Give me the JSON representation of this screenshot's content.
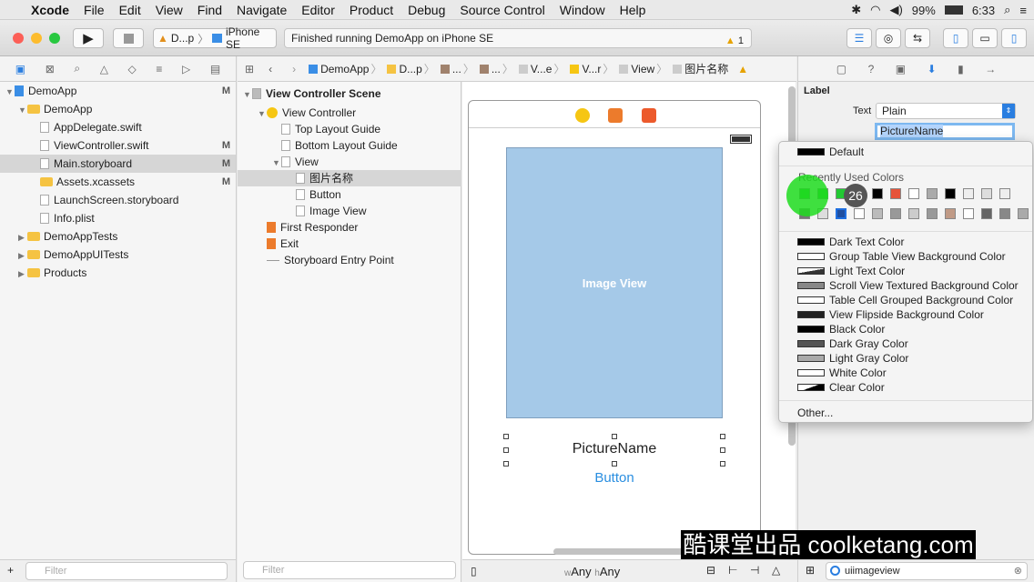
{
  "menubar": {
    "app": "Xcode",
    "items": [
      "File",
      "Edit",
      "View",
      "Find",
      "Navigate",
      "Editor",
      "Product",
      "Debug",
      "Source Control",
      "Window",
      "Help"
    ],
    "battery": "99%",
    "time": "6:33"
  },
  "toolbar": {
    "scheme": "D...p",
    "device": "iPhone SE",
    "status": "Finished running DemoApp on iPhone SE",
    "warnings": "1"
  },
  "navigator": {
    "items": [
      {
        "label": "DemoApp",
        "indent": 0,
        "tri": "▼",
        "kind": "proj",
        "flag": "M"
      },
      {
        "label": "DemoApp",
        "indent": 1,
        "tri": "▼",
        "kind": "folder",
        "flag": ""
      },
      {
        "label": "AppDelegate.swift",
        "indent": 2,
        "tri": "",
        "kind": "file",
        "flag": ""
      },
      {
        "label": "ViewController.swift",
        "indent": 2,
        "tri": "",
        "kind": "file",
        "flag": "M"
      },
      {
        "label": "Main.storyboard",
        "indent": 2,
        "tri": "",
        "kind": "file",
        "flag": "M",
        "selected": true
      },
      {
        "label": "Assets.xcassets",
        "indent": 2,
        "tri": "",
        "kind": "folder",
        "flag": "M"
      },
      {
        "label": "LaunchScreen.storyboard",
        "indent": 2,
        "tri": "",
        "kind": "file",
        "flag": ""
      },
      {
        "label": "Info.plist",
        "indent": 2,
        "tri": "",
        "kind": "file",
        "flag": ""
      },
      {
        "label": "DemoAppTests",
        "indent": 1,
        "tri": "▶",
        "kind": "folder",
        "flag": ""
      },
      {
        "label": "DemoAppUITests",
        "indent": 1,
        "tri": "▶",
        "kind": "folder",
        "flag": ""
      },
      {
        "label": "Products",
        "indent": 1,
        "tri": "▶",
        "kind": "folder",
        "flag": ""
      }
    ],
    "filter": "Filter"
  },
  "jumpbar": {
    "items": [
      "DemoApp",
      "D...p",
      "...",
      "...",
      "V...e",
      "V...r",
      "View",
      "图片名称"
    ]
  },
  "outline": {
    "scene": "View Controller Scene",
    "items": [
      {
        "label": "View Controller",
        "indent": 1,
        "tri": "▼"
      },
      {
        "label": "Top Layout Guide",
        "indent": 2,
        "tri": ""
      },
      {
        "label": "Bottom Layout Guide",
        "indent": 2,
        "tri": ""
      },
      {
        "label": "View",
        "indent": 2,
        "tri": "▼"
      },
      {
        "label": "图片名称",
        "indent": 3,
        "tri": "",
        "selected": true
      },
      {
        "label": "Button",
        "indent": 3,
        "tri": ""
      },
      {
        "label": "Image View",
        "indent": 3,
        "tri": ""
      },
      {
        "label": "First Responder",
        "indent": 1,
        "tri": ""
      },
      {
        "label": "Exit",
        "indent": 1,
        "tri": ""
      },
      {
        "label": "Storyboard Entry Point",
        "indent": 1,
        "tri": ""
      }
    ],
    "filter": "Filter"
  },
  "canvas": {
    "image_view": "Image View",
    "label_text": "PictureName",
    "button_text": "Button",
    "size_w": "Any",
    "size_h": "Any",
    "w_prefix": "w",
    "h_prefix": "h"
  },
  "inspector": {
    "section": "Label",
    "text_label": "Text",
    "text_type": "Plain",
    "text_value": "PictureName",
    "filter": "uiimageview"
  },
  "popup": {
    "default": "Default",
    "recent_title": "Recently Used Colors",
    "badge": "26",
    "colors": [
      "Dark Text Color",
      "Group Table View Background Color",
      "Light Text Color",
      "Scroll View Textured Background Color",
      "Table Cell Grouped Background Color",
      "View Flipside Background Color",
      "Black Color",
      "Dark Gray Color",
      "Light Gray Color",
      "White Color",
      "Clear Color"
    ],
    "other": "Other...",
    "swatches_row1": [
      "#22c933",
      "#22c933",
      "#22c933",
      "#555555",
      "#000000",
      "#e5533a",
      "#ffffff",
      "#aaaaaa",
      "#000000",
      "#eeeeee",
      "#dddddd",
      "#eeeeee"
    ],
    "swatches_row2": [
      "#777777",
      "#dddddd",
      "#1f4fa0",
      "#ffffff",
      "#bbbbbb",
      "#999999",
      "#cccccc",
      "#999999",
      "#c09a86",
      "#ffffff",
      "#666666",
      "#888888",
      "#aaaaaa"
    ]
  },
  "watermark": "酷课堂出品 coolketang.com"
}
